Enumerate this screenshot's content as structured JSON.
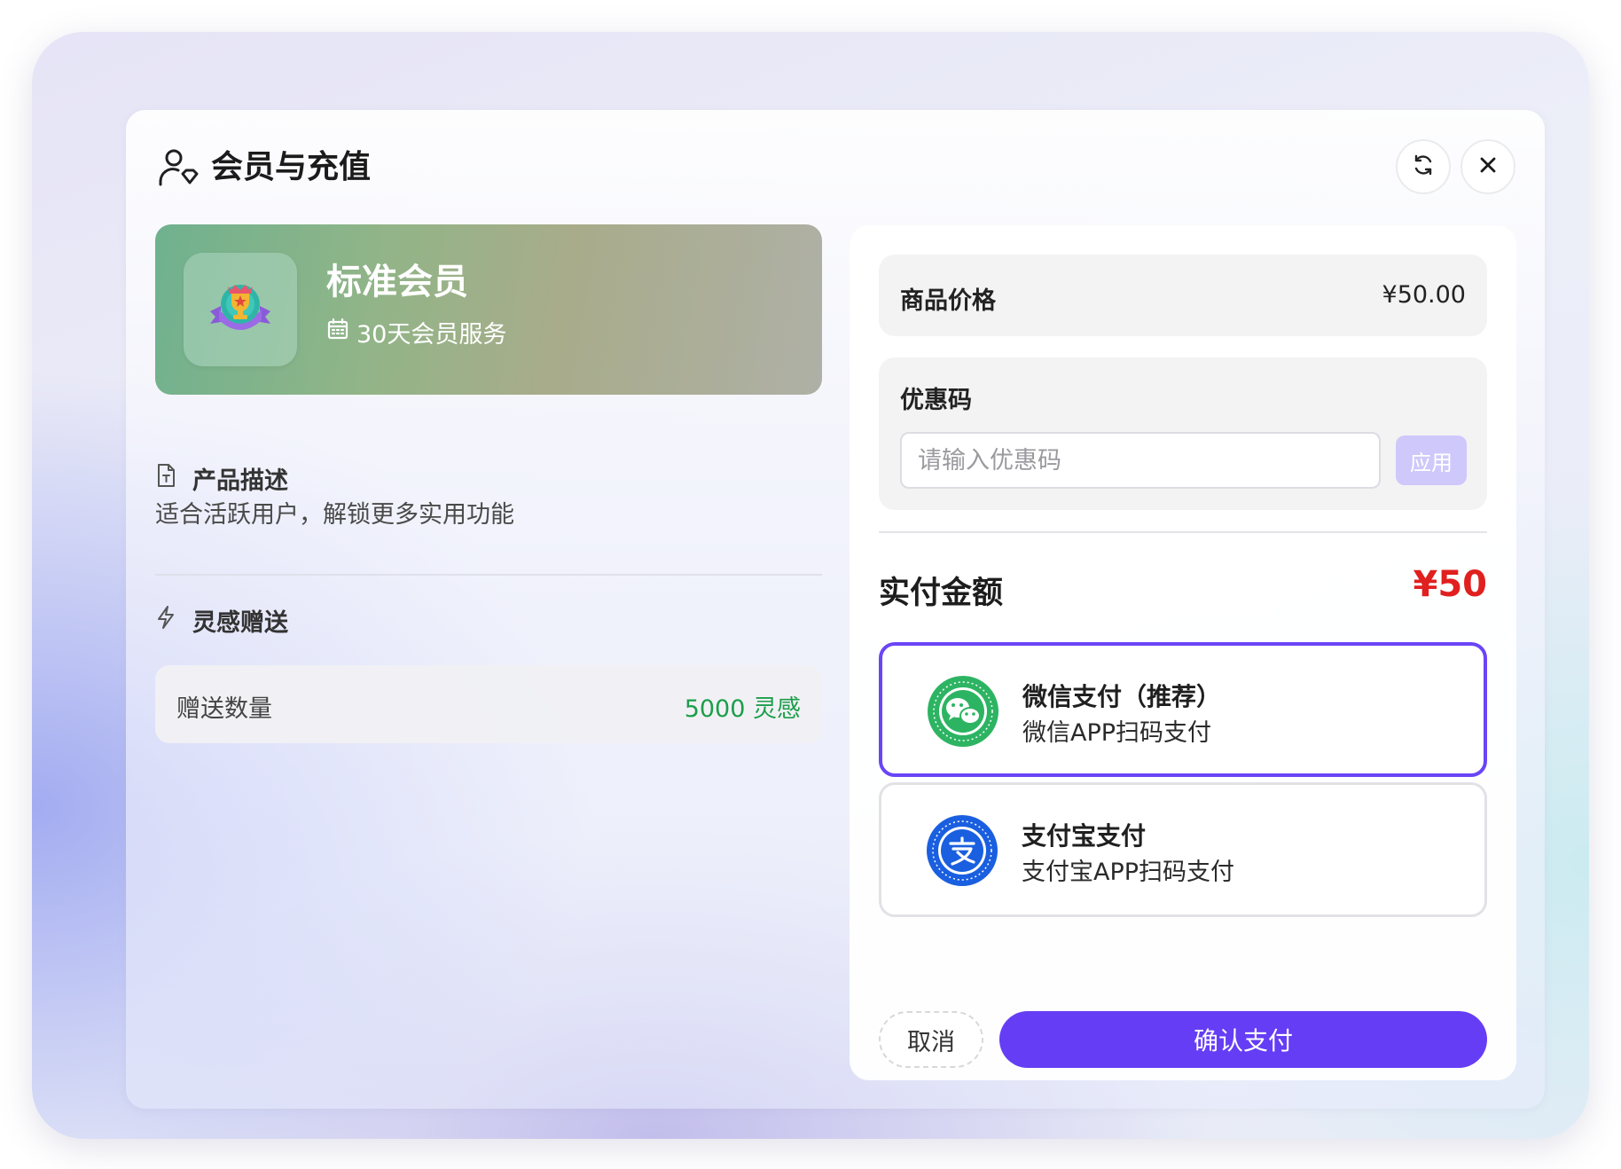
{
  "dialog": {
    "title": "会员与充值"
  },
  "member": {
    "name": "标准会员",
    "duration": "30天会员服务"
  },
  "description": {
    "heading": "产品描述",
    "text": "适合活跃用户，解锁更多实用功能"
  },
  "gift": {
    "heading": "灵感赠送",
    "label": "赠送数量",
    "value": "5000 灵感"
  },
  "price": {
    "label": "商品价格",
    "value": "¥50.00"
  },
  "coupon": {
    "label": "优惠码",
    "placeholder": "请输入优惠码",
    "value": "",
    "apply_label": "应用"
  },
  "payment": {
    "amount_label": "实付金额",
    "amount": "¥50",
    "methods": [
      {
        "title": "微信支付（推荐）",
        "subtitle": "微信APP扫码支付",
        "icon": "wechat-pay-icon",
        "selected": true,
        "color": "#2db463"
      },
      {
        "title": "支付宝支付",
        "subtitle": "支付宝APP扫码支付",
        "icon": "alipay-icon",
        "selected": false,
        "color": "#1a5fe0"
      }
    ]
  },
  "actions": {
    "cancel_label": "取消",
    "confirm_label": "确认支付"
  },
  "colors": {
    "accent": "#653df5",
    "selected_border": "#6a45f6",
    "amount": "#e0201f",
    "gift_value": "#1c9e4a",
    "apply_disabled": "#cfc8fb"
  }
}
